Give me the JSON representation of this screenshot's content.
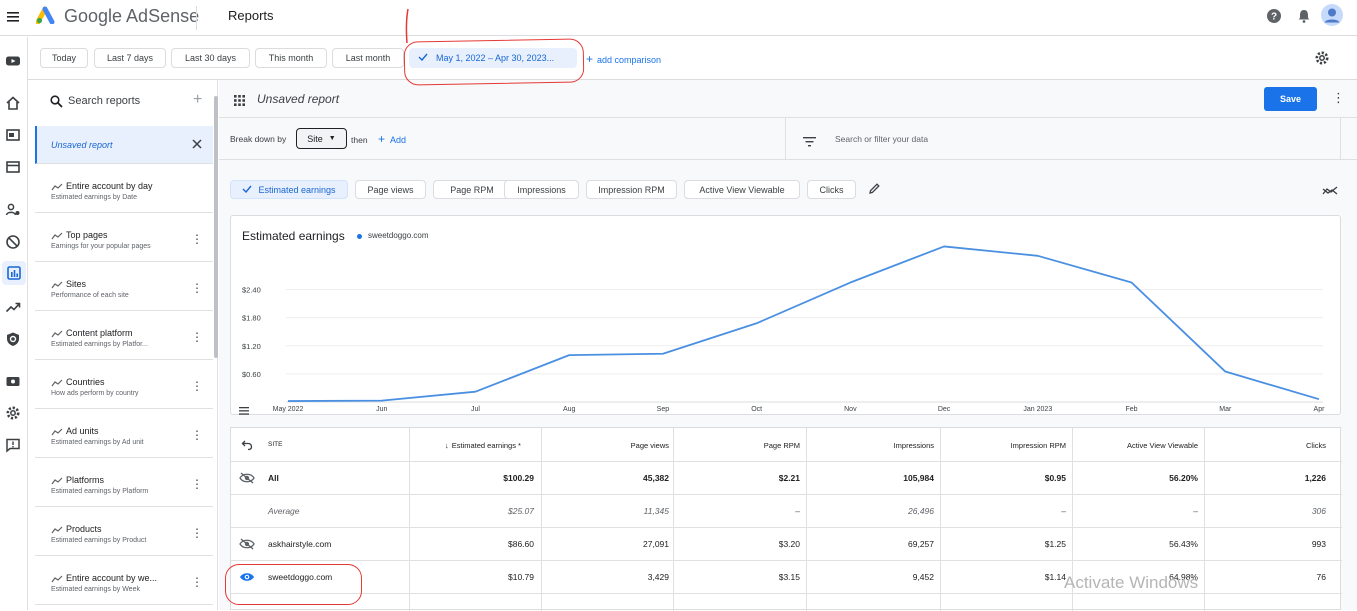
{
  "app": {
    "brand": "Google AdSense",
    "page_title": "Reports"
  },
  "date_presets": [
    "Today",
    "Last 7 days",
    "Last 30 days",
    "This month",
    "Last month"
  ],
  "date_range": "May 1, 2022 – Apr 30, 2023...",
  "add_comparison": "add comparison",
  "search_reports": "Search reports",
  "saved_reports": [
    {
      "name": "Unsaved report",
      "sub": ""
    },
    {
      "name": "Entire account by day",
      "sub": "Estimated earnings by Date"
    },
    {
      "name": "Top pages",
      "sub": "Earnings for your popular pages"
    },
    {
      "name": "Sites",
      "sub": "Performance of each site"
    },
    {
      "name": "Content platform",
      "sub": "Estimated earnings by Platfor..."
    },
    {
      "name": "Countries",
      "sub": "How ads perform by country"
    },
    {
      "name": "Ad units",
      "sub": "Estimated earnings by Ad unit"
    },
    {
      "name": "Platforms",
      "sub": "Estimated earnings by Platform"
    },
    {
      "name": "Products",
      "sub": "Estimated earnings by Product"
    },
    {
      "name": "Entire account by we...",
      "sub": "Estimated earnings by Week"
    }
  ],
  "report": {
    "title": "Unsaved report",
    "save_label": "Save"
  },
  "breakdown": {
    "label": "Break down by",
    "value": "Site",
    "then": "then",
    "add": "Add",
    "filter_placeholder": "Search or filter your data"
  },
  "metrics": [
    "Estimated earnings",
    "Page views",
    "Page RPM",
    "Impressions",
    "Impression RPM",
    "Active View Viewable",
    "Clicks"
  ],
  "chart_data": {
    "type": "line",
    "title": "Estimated earnings",
    "series": [
      {
        "name": "sweetdoggo.com",
        "color": "#4a90e2",
        "values": [
          0.02,
          0.03,
          0.22,
          1.0,
          1.03,
          1.68,
          2.55,
          3.32,
          3.12,
          2.55,
          0.65,
          0.06
        ]
      }
    ],
    "categories": [
      "May 2022",
      "Jun",
      "Jul",
      "Aug",
      "Sep",
      "Oct",
      "Nov",
      "Dec",
      "Jan 2023",
      "Feb",
      "Mar",
      "Apr"
    ],
    "yticks": [
      "$0.60",
      "$1.20",
      "$1.80",
      "$2.40"
    ],
    "ylim": [
      0,
      3.5
    ],
    "grid": true,
    "legend": "top-left"
  },
  "table": {
    "columns": [
      "SITE",
      "Estimated earnings *",
      "Page views",
      "Page RPM",
      "Impressions",
      "Impression RPM",
      "Active View Viewable",
      "Clicks"
    ],
    "rows": [
      {
        "site": "All",
        "bold": true,
        "values": [
          "$100.29",
          "45,382",
          "$2.21",
          "105,984",
          "$0.95",
          "56.20%",
          "1,226"
        ]
      },
      {
        "site": "Average",
        "italic": true,
        "values": [
          "$25.07",
          "11,345",
          "–",
          "26,496",
          "–",
          "–",
          "306"
        ]
      },
      {
        "site": "askhairstyle.com",
        "values": [
          "$86.60",
          "27,091",
          "$3.20",
          "69,257",
          "$1.25",
          "56.43%",
          "993"
        ]
      },
      {
        "site": "sweetdoggo.com",
        "values": [
          "$10.79",
          "3,429",
          "$3.15",
          "9,452",
          "$1.14",
          "64.98%",
          "76"
        ]
      }
    ]
  },
  "watermark": "Activate Windows",
  "colors": {
    "accent": "#1a73e8",
    "annotation": "#e53935",
    "line": "#4a90e2"
  }
}
